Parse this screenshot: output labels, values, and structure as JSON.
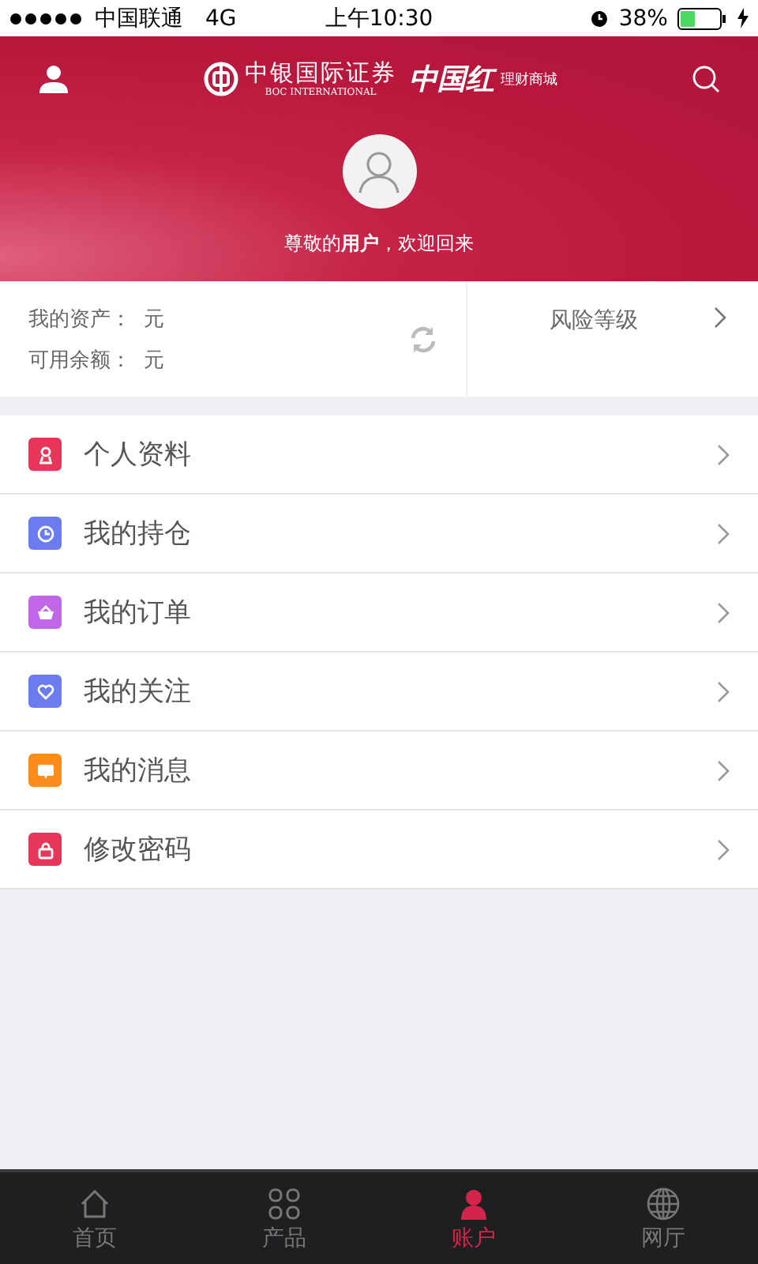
{
  "status_bar": {
    "carrier": "中国联通",
    "network": "4G",
    "time": "上午10:30",
    "battery_text": "38%",
    "battery": {
      "level": 0.38
    }
  },
  "header": {
    "logo_cn": "中银国际证券",
    "logo_en": "BOC INTERNATIONAL",
    "brand": "中国红",
    "brand_sub": "理财商城",
    "welcome": "尊敬的**用户**，欢迎回来"
  },
  "assets": {
    "rows": [
      {
        "label": "我的资产：",
        "value": "元"
      },
      {
        "label": "可用余额：",
        "value": "元"
      }
    ],
    "risk": "风险等级"
  },
  "menu": [
    {
      "kind": "person",
      "label": "个人资料",
      "color": "#e8365a"
    },
    {
      "kind": "clock",
      "label": "我的持仓",
      "color": "#6a7cf0"
    },
    {
      "kind": "basket",
      "label": "我的订单",
      "color": "#c066e6"
    },
    {
      "kind": "heart",
      "label": "我的关注",
      "color": "#6a7cf0"
    },
    {
      "kind": "message",
      "label": "我的消息",
      "color": "#ff8c1a"
    },
    {
      "kind": "lock",
      "label": "修改密码",
      "color": "#e8365a"
    }
  ],
  "tabs": [
    {
      "kind": "home",
      "label": "首页",
      "selected": false
    },
    {
      "kind": "grid",
      "label": "产品",
      "selected": false
    },
    {
      "kind": "person",
      "label": "账户",
      "selected": true
    },
    {
      "kind": "globe",
      "label": "网厅",
      "selected": false
    }
  ]
}
